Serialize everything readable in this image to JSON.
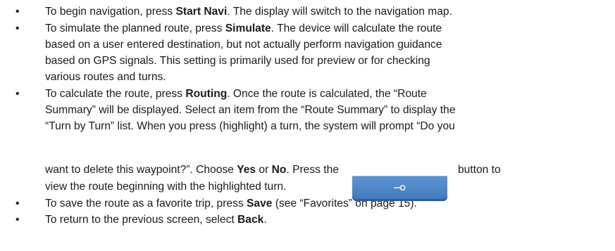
{
  "items": [
    {
      "lines": [
        [
          "To begin navigation, press ",
          {
            "b": "Start Navi"
          },
          ". The display will switch to the navigation map."
        ]
      ]
    },
    {
      "lines": [
        [
          "To simulate the planned route, press ",
          {
            "b": "Simulate"
          },
          ". The device will calculate the route"
        ],
        [
          "based on a user entered destination, but not actually perform navigation guidance"
        ],
        [
          "based on GPS signals. This setting is primarily used for preview or for checking"
        ],
        [
          "various routes and turns."
        ]
      ]
    },
    {
      "lines": [
        [
          "To calculate the route, press ",
          {
            "b": "Routing"
          },
          ". Once the route is calculated, the “Route"
        ],
        [
          "Summary” will be displayed. Select an item from the “Route Summary” to display the"
        ],
        [
          "“Turn by Turn” list. When you press (highlight) a turn, the system will prompt “Do you"
        ],
        [
          "want to delete this waypoint?”. Choose ",
          {
            "b": "Yes"
          },
          " or ",
          {
            "b": "No"
          },
          ". Press the"
        ],
        [
          "view the route beginning with the highlighted turn."
        ]
      ],
      "after_button": "button to"
    },
    {
      "lines": [
        [
          "To save the route as a favorite trip, press ",
          {
            "b": "Save"
          },
          " (see “Favorites” on page 15)."
        ]
      ]
    },
    {
      "lines": [
        [
          "To return to the previous screen, select ",
          {
            "b": "Back"
          },
          "."
        ]
      ]
    }
  ],
  "bullet_char": "•",
  "inline_button_icon": "arrow-right-icon"
}
